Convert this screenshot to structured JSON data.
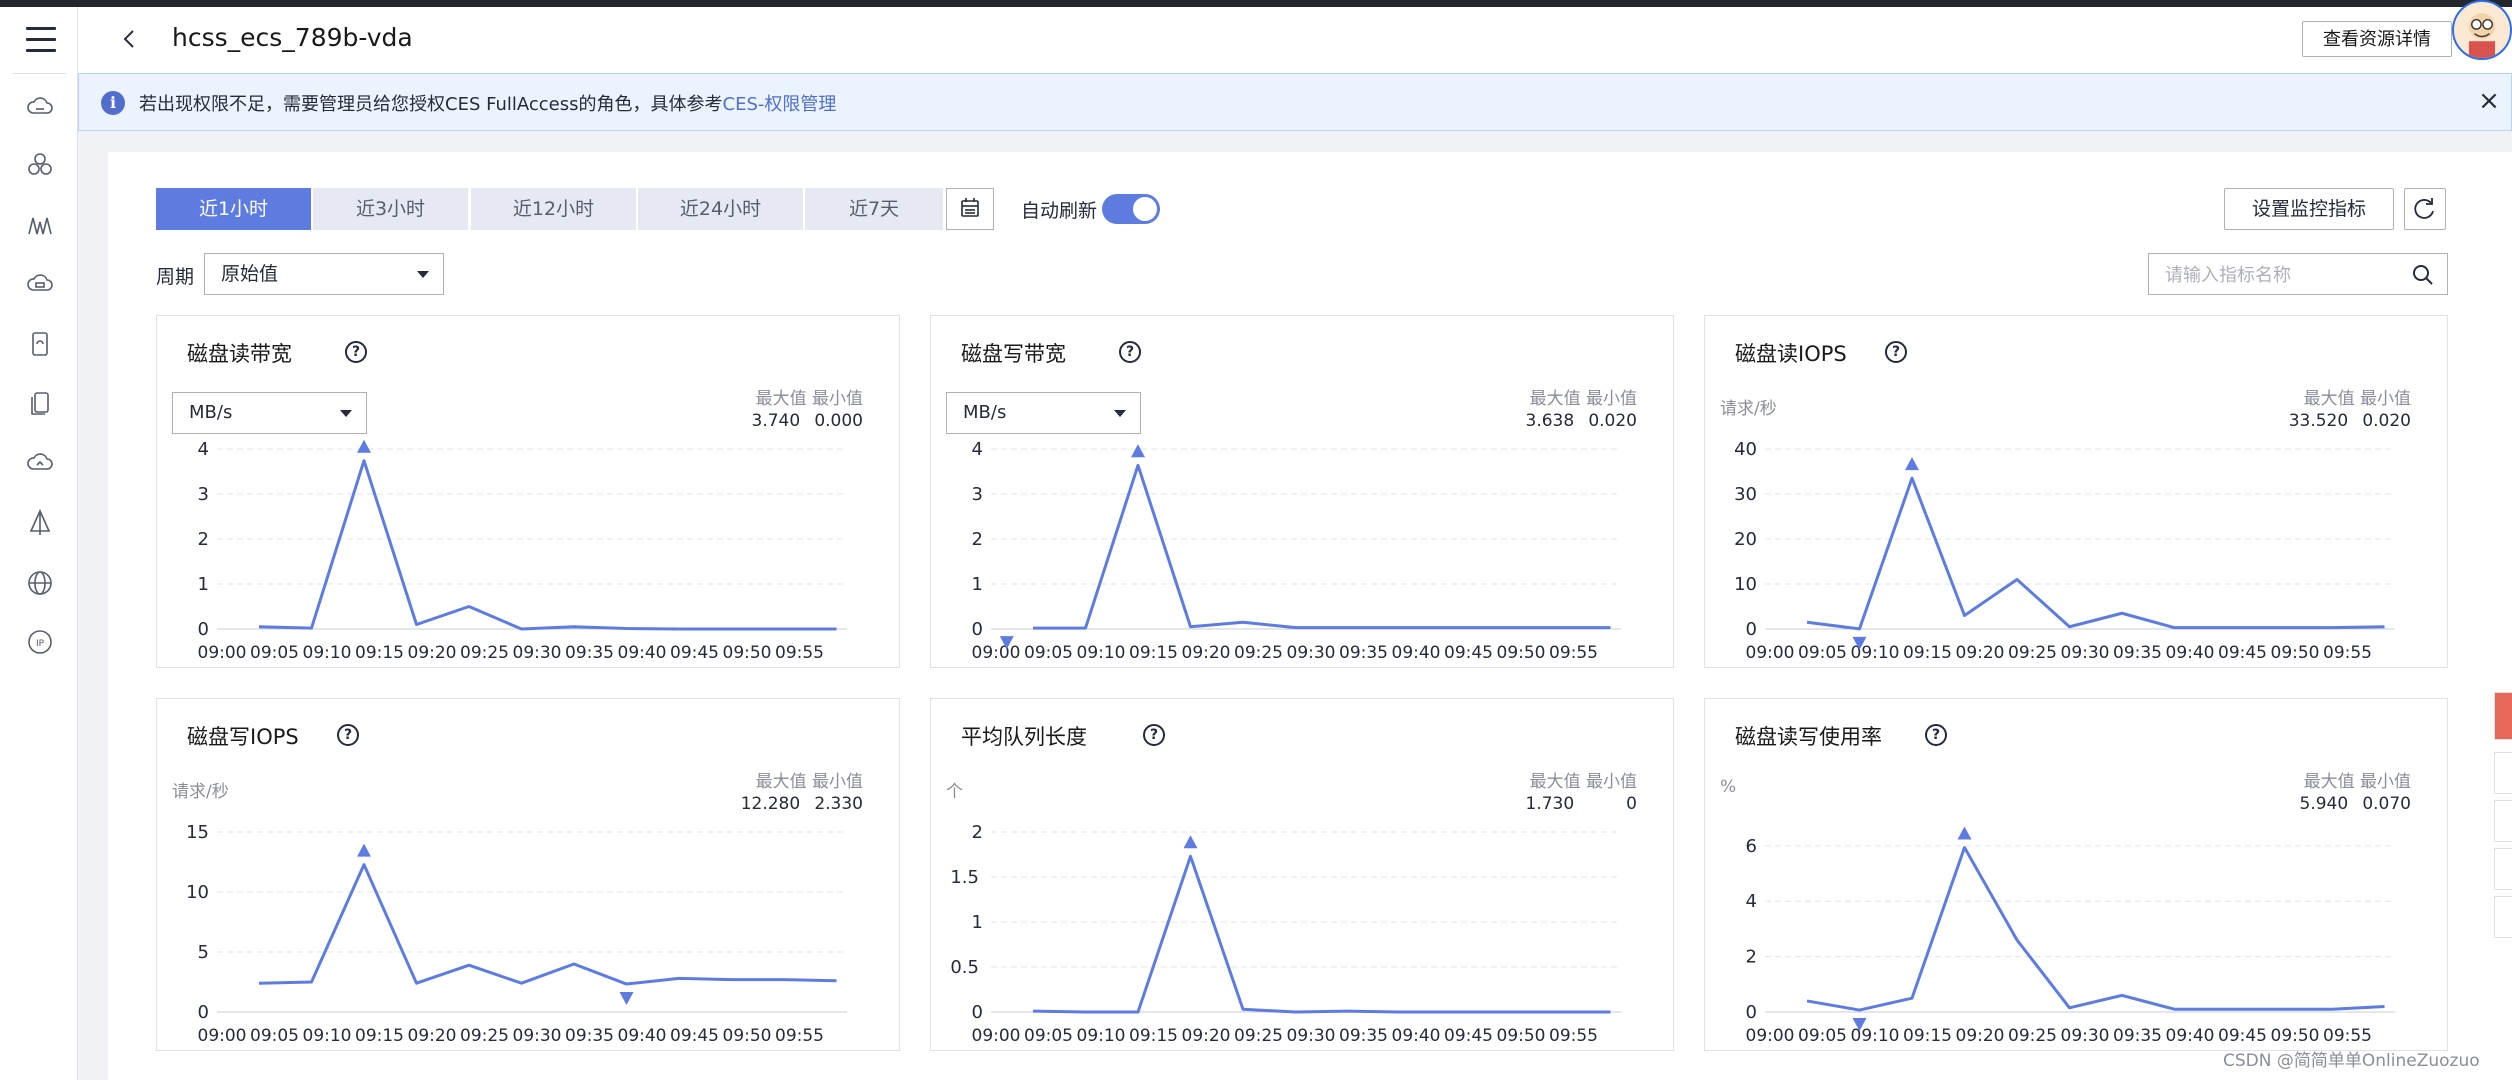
{
  "header": {
    "title": "hcss_ecs_789b-vda",
    "resource_button": "查看资源详情"
  },
  "notice": {
    "text": "若出现权限不足，需要管理员给您授权CES FullAccess的角色，具体参考",
    "link": "CES-权限管理"
  },
  "toolbar": {
    "ranges": [
      "近1小时",
      "近3小时",
      "近12小时",
      "近24小时",
      "近7天"
    ],
    "active_range": "近1小时",
    "auto_refresh_label": "自动刷新",
    "auto_refresh_on": true,
    "set_metrics_button": "设置监控指标",
    "period_label": "周期",
    "period_value": "原始值",
    "search_placeholder": "请输入指标名称"
  },
  "stat_labels": {
    "max": "最大值",
    "min": "最小值"
  },
  "x_ticks": [
    "09:00",
    "09:05",
    "09:10",
    "09:15",
    "09:20",
    "09:25",
    "09:30",
    "09:35",
    "09:40",
    "09:45",
    "09:50",
    "09:55"
  ],
  "charts": [
    {
      "title": "磁盘读带宽",
      "unit": "MB/s",
      "unit_select": true,
      "max": "3.740",
      "min": "0.000",
      "yticks": [
        0,
        1,
        2,
        3,
        4
      ],
      "ylim": [
        0,
        4
      ],
      "x": [
        0.8,
        1.8,
        2.8,
        3.8,
        4.8,
        5.8,
        6.8,
        7.8,
        8.8,
        9.8,
        10.8,
        11.8
      ],
      "values": [
        0.05,
        0.02,
        3.74,
        0.1,
        0.5,
        0.0,
        0.05,
        0.01,
        0.0,
        0.0,
        0.0,
        0.0
      ],
      "max_marker": {
        "x": 2.8,
        "y": 3.74
      },
      "min_marker": null,
      "color": "#5e7ce0"
    },
    {
      "title": "磁盘写带宽",
      "unit": "MB/s",
      "unit_select": true,
      "max": "3.638",
      "min": "0.020",
      "yticks": [
        0,
        1,
        2,
        3,
        4
      ],
      "ylim": [
        0,
        4
      ],
      "x": [
        0.8,
        1.8,
        2.8,
        3.8,
        4.8,
        5.8,
        6.8,
        7.8,
        8.8,
        9.8,
        10.8,
        11.8
      ],
      "values": [
        0.02,
        0.02,
        3.638,
        0.05,
        0.15,
        0.03,
        0.03,
        0.03,
        0.03,
        0.03,
        0.03,
        0.03
      ],
      "max_marker": {
        "x": 2.8,
        "y": 3.638
      },
      "min_marker": {
        "x": 0.3,
        "y": 0.02
      },
      "color": "#5e7ce0"
    },
    {
      "title": "磁盘读IOPS",
      "unit": "请求/秒",
      "unit_select": false,
      "max": "33.520",
      "min": "0.020",
      "yticks": [
        0,
        10,
        20,
        30,
        40
      ],
      "ylim": [
        0,
        40
      ],
      "x": [
        0.8,
        1.8,
        2.8,
        3.8,
        4.8,
        5.8,
        6.8,
        7.8,
        8.8,
        9.8,
        10.8,
        11.8
      ],
      "values": [
        1.5,
        0.02,
        33.52,
        3.0,
        11.0,
        0.5,
        3.5,
        0.3,
        0.3,
        0.3,
        0.3,
        0.5
      ],
      "max_marker": {
        "x": 2.8,
        "y": 33.52
      },
      "min_marker": {
        "x": 1.8,
        "y": 0.02
      },
      "color": "#5e7ce0"
    },
    {
      "title": "磁盘写IOPS",
      "unit": "请求/秒",
      "unit_select": false,
      "max": "12.280",
      "min": "2.330",
      "yticks": [
        0,
        5,
        10,
        15
      ],
      "ylim": [
        0,
        15
      ],
      "x": [
        0.8,
        1.8,
        2.8,
        3.8,
        4.8,
        5.8,
        6.8,
        7.8,
        8.8,
        9.8,
        10.8,
        11.8
      ],
      "values": [
        2.4,
        2.5,
        12.28,
        2.4,
        3.9,
        2.4,
        4.0,
        2.33,
        2.8,
        2.7,
        2.7,
        2.6
      ],
      "max_marker": {
        "x": 2.8,
        "y": 12.28
      },
      "min_marker": {
        "x": 7.8,
        "y": 2.33
      },
      "color": "#5e7ce0"
    },
    {
      "title": "平均队列长度",
      "unit": "个",
      "unit_select": false,
      "max": "1.730",
      "min": "0",
      "yticks": [
        0,
        0.5,
        1,
        1.5,
        2
      ],
      "ylim": [
        0,
        2
      ],
      "x": [
        0.8,
        1.8,
        2.8,
        3.8,
        4.8,
        5.8,
        6.8,
        7.8,
        8.8,
        9.8,
        10.8,
        11.8
      ],
      "values": [
        0.01,
        0,
        0,
        1.73,
        0.03,
        0,
        0.01,
        0,
        0,
        0,
        0,
        0
      ],
      "max_marker": {
        "x": 3.8,
        "y": 1.73
      },
      "min_marker": null,
      "color": "#5e7ce0"
    },
    {
      "title": "磁盘读写使用率",
      "unit": "%",
      "unit_select": false,
      "max": "5.940",
      "min": "0.070",
      "yticks": [
        0,
        2,
        4,
        6
      ],
      "ylim": [
        0,
        6.5
      ],
      "x": [
        0.8,
        1.8,
        2.8,
        3.8,
        4.8,
        5.8,
        6.8,
        7.8,
        8.8,
        9.8,
        10.8,
        11.8
      ],
      "values": [
        0.4,
        0.07,
        0.5,
        5.94,
        2.6,
        0.15,
        0.6,
        0.1,
        0.1,
        0.1,
        0.1,
        0.2
      ],
      "max_marker": {
        "x": 3.8,
        "y": 5.94
      },
      "min_marker": {
        "x": 1.8,
        "y": 0.07
      },
      "color": "#5e7ce0"
    }
  ],
  "watermark": "CSDN @简简单单OnlineZuozuo"
}
